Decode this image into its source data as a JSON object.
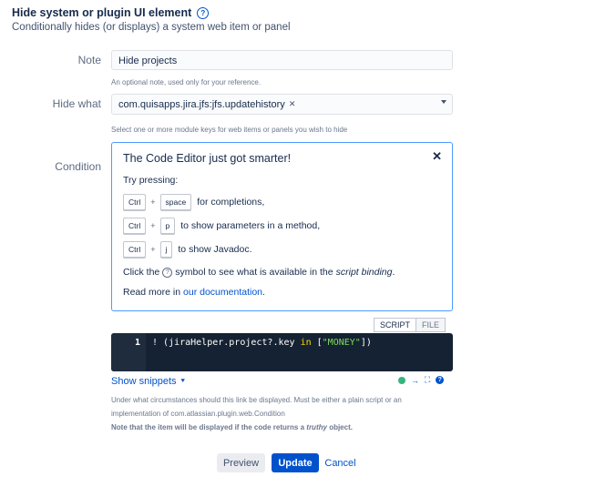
{
  "header": {
    "title": "Hide system or plugin UI element",
    "subtitle": "Conditionally hides (or displays) a system web item or panel"
  },
  "note": {
    "label": "Note",
    "value": "Hide projects",
    "hint": "An optional note, used only for your reference."
  },
  "hide_what": {
    "label": "Hide what",
    "selected": "com.quisapps.jira.jfs:jfs.updatehistory",
    "hint": "Select one or more module keys for web items or panels you wish to hide"
  },
  "condition": {
    "label": "Condition",
    "panel": {
      "title": "The Code Editor just got smarter!",
      "try_pressing": "Try pressing:",
      "shortcuts": [
        {
          "mod": "Ctrl",
          "key": "space",
          "text": "for completions,"
        },
        {
          "mod": "Ctrl",
          "key": "p",
          "text": "to show parameters in a method,"
        },
        {
          "mod": "Ctrl",
          "key": "j",
          "text": "to show Javadoc."
        }
      ],
      "click_prefix": "Click the",
      "click_suffix": "symbol to see what is available in the",
      "script_binding": "script binding",
      "period": ".",
      "read_more": "Read more in",
      "documentation": "our documentation",
      "read_more_end": "."
    },
    "tabs": [
      "SCRIPT",
      "FILE"
    ],
    "editor": {
      "line_number": "1",
      "code_prefix": "! (jiraHelper.project?.key ",
      "code_keyword": "in",
      "code_mid": " [",
      "code_string": "\"MONEY\"",
      "code_suffix": "])"
    },
    "show_snippets": "Show snippets",
    "description_1": "Under what circumstances should this link be displayed. Must be either a plain script or an",
    "description_2": "implementation of com.atlassian.plugin.web.Condition",
    "description_3a": "Note that the item will be displayed if the code returns a",
    "description_3b": "truthy",
    "description_3c": "object."
  },
  "buttons": {
    "preview": "Preview",
    "update": "Update",
    "cancel": "Cancel"
  },
  "colors": {
    "primary": "#0052cc",
    "editor_bg": "#152233",
    "focus_border": "#4c9aff"
  }
}
